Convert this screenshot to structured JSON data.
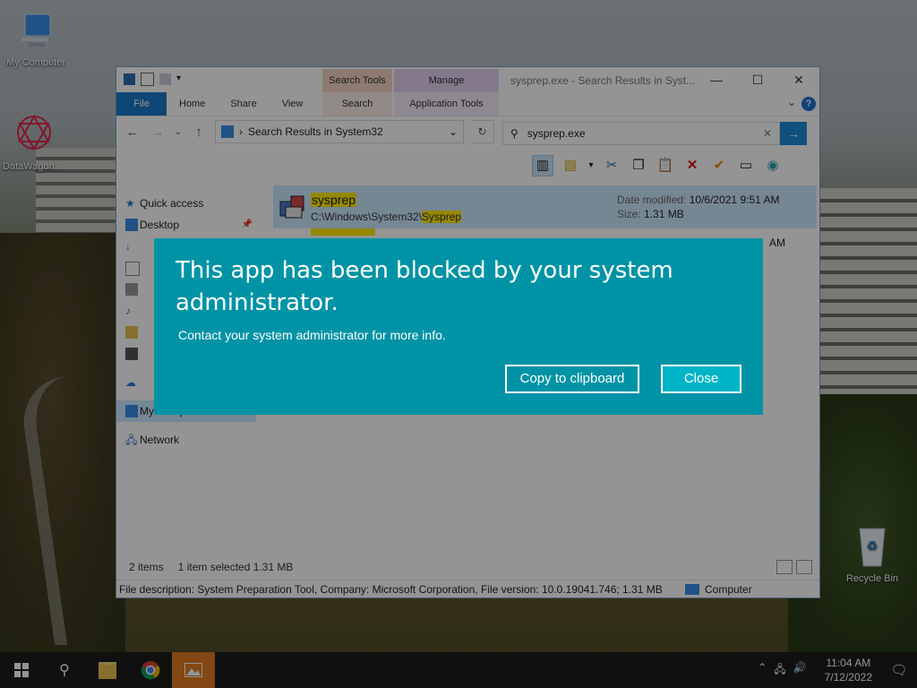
{
  "desktop": {
    "icons": [
      {
        "label": "My Computer",
        "icon": "computer-icon"
      },
      {
        "label": "DataWagon....",
        "icon": "datawagon-icon"
      },
      {
        "label": "Recycle Bin",
        "icon": "recycle-bin-icon"
      }
    ]
  },
  "explorer": {
    "title": "sysprep.exe - Search Results in Syst...",
    "context_groups": [
      "Search Tools",
      "Manage"
    ],
    "tabs": [
      "File",
      "Home",
      "Share",
      "View",
      "Search",
      "Application Tools"
    ],
    "path": "Search Results in System32",
    "search_value": "sysprep.exe",
    "nav": [
      "Quick access",
      "Desktop",
      "My Computer",
      "Network"
    ],
    "results": [
      {
        "name": "sysprep",
        "path_prefix": "C:\\Windows\\System32\\",
        "path_highlight": "Sysprep",
        "date_label": "Date modified:",
        "date": "10/6/2021 9:51 AM",
        "size_label": "Size:",
        "size": "1.31 MB"
      },
      {
        "date_fragment": "AM"
      }
    ],
    "status": {
      "items": "2 items",
      "selected": "1 item selected  1.31 MB"
    },
    "description": "File description: System Preparation Tool, Company: Microsoft Corporation, File version: 10.0.19041.746; 1.31 MB",
    "location": "Computer"
  },
  "dialog": {
    "title": "This app has been blocked by your system administrator.",
    "message": "Contact your system administrator for more info.",
    "copy_button": "Copy to clipboard",
    "close_button": "Close",
    "background": "#0093a6"
  },
  "taskbar": {
    "time": "11:04 AM",
    "date": "7/12/2022"
  }
}
